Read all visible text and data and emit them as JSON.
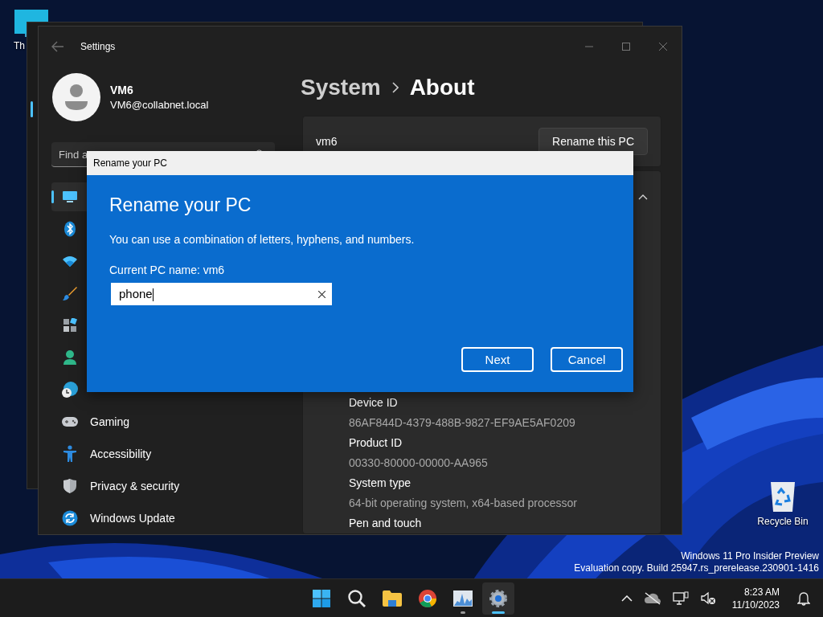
{
  "desktop": {
    "icons": [
      {
        "label": "Th"
      },
      {
        "label": "Recycle Bin"
      }
    ],
    "watermark": [
      "Windows 11 Pro Insider Preview",
      "Evaluation copy. Build 25947.rs_prerelease.230901-1416"
    ]
  },
  "settings": {
    "title": "Settings",
    "user": {
      "name": "VM6",
      "email": "VM6@collabnet.local"
    },
    "search": {
      "placeholder": "Find a"
    },
    "nav": [
      {
        "selected": true
      },
      {
        "selected": false
      },
      {
        "selected": false
      },
      {
        "selected": false
      },
      {
        "selected": false
      },
      {
        "selected": false
      },
      {
        "selected": false
      },
      {
        "label": "Gaming",
        "selected": false
      },
      {
        "label": "Accessibility",
        "selected": false
      },
      {
        "label": "Privacy & security",
        "selected": false
      },
      {
        "label": "Windows Update",
        "selected": false
      }
    ],
    "breadcrumb": {
      "parent": "System",
      "current": "About"
    },
    "device": {
      "name": "vm6",
      "button": "Rename this PC"
    },
    "specs": {
      "expanded": true,
      "rows": [
        {
          "label": "Device ID",
          "value": "86AF844D-4379-488B-9827-EF9AE5AF0209"
        },
        {
          "label": "Product ID",
          "value": "00330-80000-00000-AA965"
        },
        {
          "label": "System type",
          "value": "64-bit operating system, x64-based processor"
        },
        {
          "label": "Pen and touch"
        }
      ]
    }
  },
  "dialog": {
    "title": "Rename your PC",
    "heading": "Rename your PC",
    "description": "You can use a combination of letters, hyphens, and numbers.",
    "current_name": "Current PC name: vm6",
    "input": {
      "value": "phone"
    },
    "buttons": [
      "Next",
      "Cancel"
    ]
  },
  "taskbar": {
    "apps": [
      {
        "selected": false,
        "running": false
      },
      {
        "selected": false,
        "running": false
      },
      {
        "selected": false,
        "running": false
      },
      {
        "selected": false,
        "running": false
      },
      {
        "selected": false,
        "running": true
      },
      {
        "selected": true,
        "running": true
      }
    ],
    "clock": {
      "time": "8:23 AM",
      "date": "11/10/2023"
    }
  }
}
